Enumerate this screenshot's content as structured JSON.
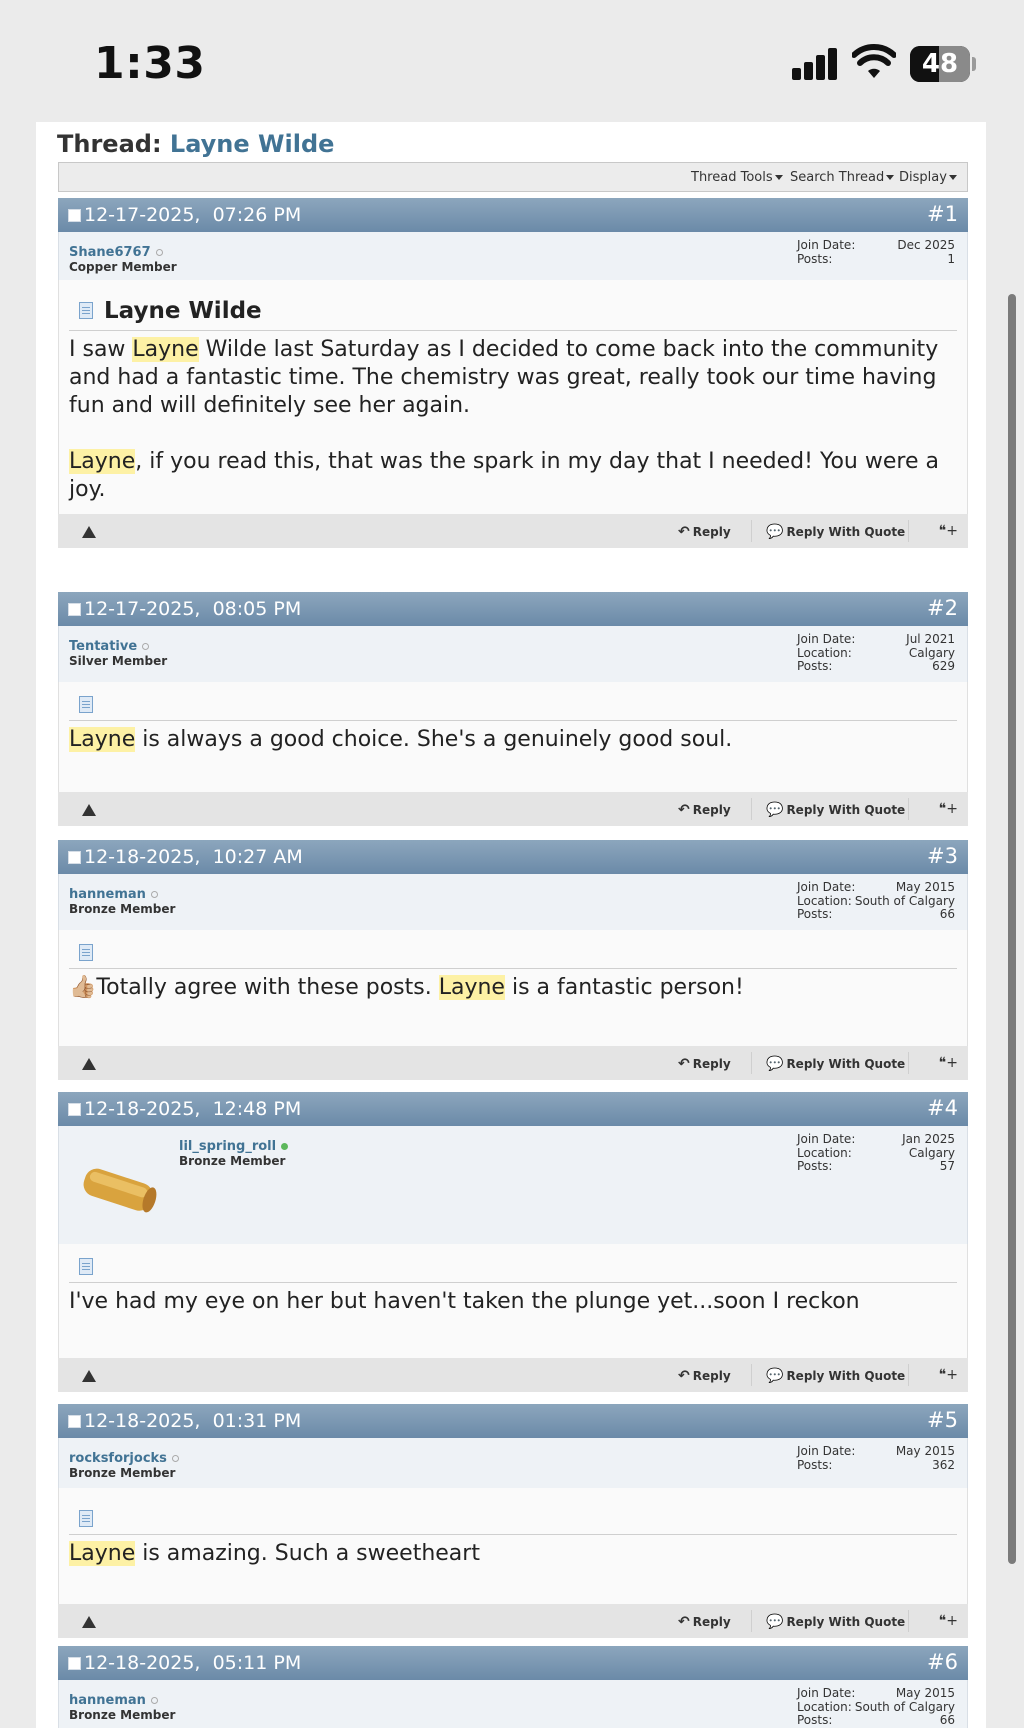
{
  "status_bar": {
    "time": "1:33",
    "battery": "48",
    "battery_level": 0.48
  },
  "thread": {
    "prefix": "Thread:",
    "name": "Layne Wilde",
    "tools": [
      "Thread Tools",
      "Search Thread",
      "Display"
    ]
  },
  "footer_labels": {
    "reply": "Reply",
    "reply_quote": "Reply With Quote"
  },
  "posts": [
    {
      "date": "12-17-2025,",
      "time": "07:26 PM",
      "number": "#1",
      "username": "Shane6767",
      "user_title": "Copper Member",
      "stats": [
        [
          "Join Date:",
          "Dec 2025"
        ],
        [
          "Posts:",
          "1"
        ]
      ],
      "title": "Layne Wilde",
      "p1_hl": "Layne",
      "p1_rest": " Wilde last Saturday as I decided to come back into the community and had a fantastic time. The chemistry was great, really took our time having fun and will definitely see her again.",
      "p1_pre": "I saw ",
      "p2_hl": "Layne",
      "p2_rest": ", if you read this, that was the spark in my day that I needed! You were a joy."
    },
    {
      "date": "12-17-2025,",
      "time": "08:05 PM",
      "number": "#2",
      "username": "Tentative",
      "user_title": "Silver Member",
      "stats": [
        [
          "Join Date:",
          "Jul 2021"
        ],
        [
          "Location:",
          "Calgary"
        ],
        [
          "Posts:",
          "629"
        ]
      ],
      "hl": "Layne",
      "rest": " is always a good choice. She's a genuinely good soul."
    },
    {
      "date": "12-18-2025,",
      "time": "10:27 AM",
      "number": "#3",
      "username": "hanneman",
      "user_title": "Bronze Member",
      "stats": [
        [
          "Join Date:",
          "May 2015"
        ],
        [
          "Location:",
          "South of Calgary"
        ],
        [
          "Posts:",
          "66"
        ]
      ],
      "emoji": "👍🏼",
      "pre": "Totally agree with these posts. ",
      "hl": "Layne",
      "rest": " is a fantastic person!"
    },
    {
      "date": "12-18-2025,",
      "time": "12:48 PM",
      "number": "#4",
      "username": "lil_spring_roll",
      "user_title": "Bronze Member",
      "stats": [
        [
          "Join Date:",
          "Jan 2025"
        ],
        [
          "Location:",
          "Calgary"
        ],
        [
          "Posts:",
          "57"
        ]
      ],
      "avatar": "spring-roll",
      "text": "I've had my eye on her but haven't taken the plunge yet...soon I reckon"
    },
    {
      "date": "12-18-2025,",
      "time": "01:31 PM",
      "number": "#5",
      "username": "rocksforjocks",
      "user_title": "Bronze Member",
      "stats": [
        [
          "Join Date:",
          "May 2015"
        ],
        [
          "Posts:",
          "362"
        ]
      ],
      "hl": "Layne",
      "rest": " is amazing. Such a sweetheart"
    },
    {
      "date": "12-18-2025,",
      "time": "05:11 PM",
      "number": "#6",
      "username": "hanneman",
      "user_title": "Bronze Member",
      "stats": [
        [
          "Join Date:",
          "May 2015"
        ],
        [
          "Location:",
          "South of Calgary"
        ],
        [
          "Posts:",
          "66"
        ]
      ]
    }
  ],
  "colors": {
    "post_header": "#6b8aa8",
    "link": "#417394",
    "highlight": "#fdf1a5"
  }
}
